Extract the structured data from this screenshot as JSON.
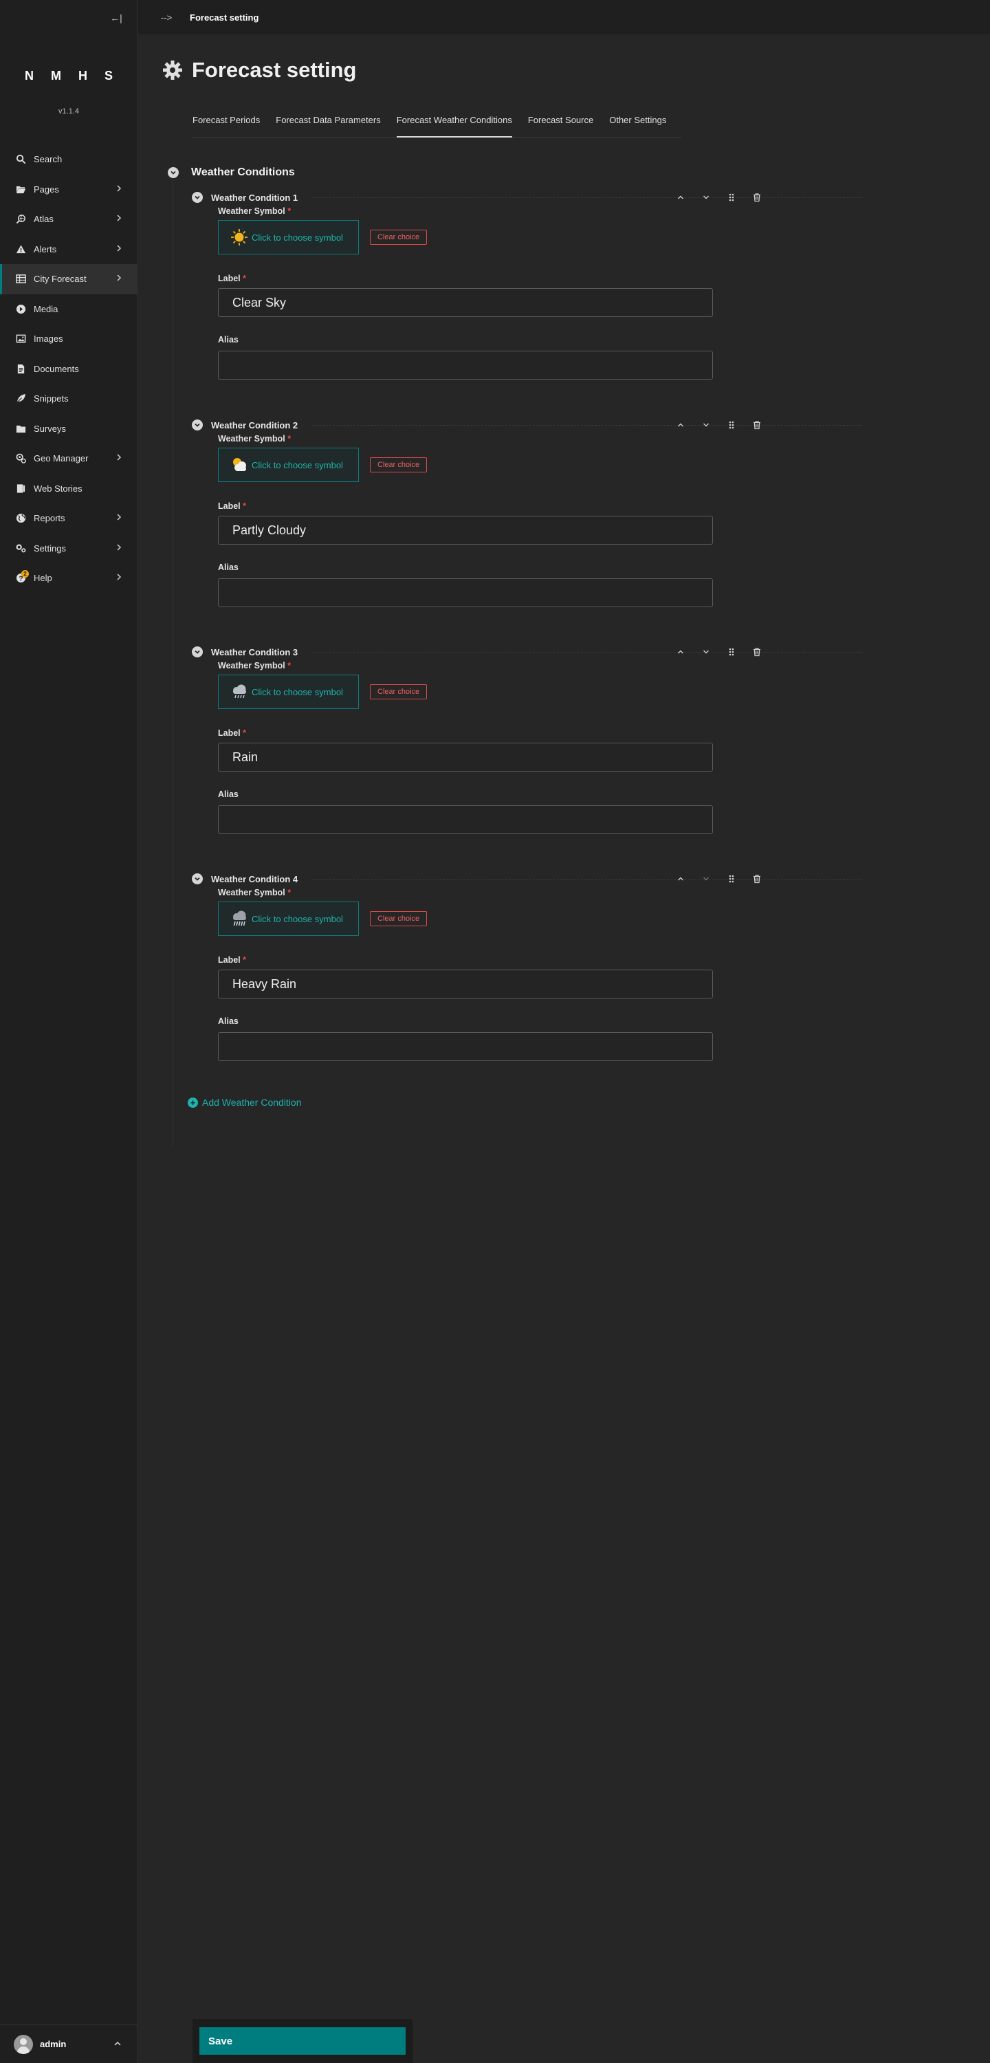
{
  "sidebar": {
    "collapse_label": "←|",
    "logo": "N M H S",
    "version": "v1.1.4",
    "items": [
      {
        "label": "Search",
        "icon": "search-icon",
        "chevron": false
      },
      {
        "label": "Pages",
        "icon": "folder-open-icon",
        "chevron": true
      },
      {
        "label": "Atlas",
        "icon": "globe-search-icon",
        "chevron": true
      },
      {
        "label": "Alerts",
        "icon": "warning-icon",
        "chevron": true
      },
      {
        "label": "City Forecast",
        "icon": "table-icon",
        "chevron": true,
        "active": true
      },
      {
        "label": "Media",
        "icon": "play-icon",
        "chevron": false
      },
      {
        "label": "Images",
        "icon": "image-icon",
        "chevron": false
      },
      {
        "label": "Documents",
        "icon": "document-icon",
        "chevron": false
      },
      {
        "label": "Snippets",
        "icon": "leaf-icon",
        "chevron": false
      },
      {
        "label": "Surveys",
        "icon": "folder-icon",
        "chevron": false
      },
      {
        "label": "Geo Manager",
        "icon": "map-settings-icon",
        "chevron": true
      },
      {
        "label": "Web Stories",
        "icon": "book-icon",
        "chevron": false
      },
      {
        "label": "Reports",
        "icon": "globe-icon",
        "chevron": true
      },
      {
        "label": "Settings",
        "icon": "cogs-icon",
        "chevron": true
      },
      {
        "label": "Help",
        "icon": "help-icon",
        "chevron": true,
        "badge": "2"
      }
    ],
    "account": {
      "name": "admin"
    }
  },
  "topbar": {
    "arrow": "-->",
    "breadcrumb": "Forecast setting"
  },
  "header": {
    "title": "Forecast setting",
    "icon": "gear-icon"
  },
  "tabs": [
    {
      "label": "Forecast Periods"
    },
    {
      "label": "Forecast Data Parameters"
    },
    {
      "label": "Forecast Weather Conditions",
      "active": true
    },
    {
      "label": "Forecast Source"
    },
    {
      "label": "Other Settings"
    }
  ],
  "section": {
    "title": "Weather Conditions"
  },
  "conditions": [
    {
      "title": "Weather Condition 1",
      "symbol_label": "Weather Symbol",
      "choose": "Click to choose symbol",
      "clear": "Clear choice",
      "label_caption": "Label",
      "label_value": "Clear Sky",
      "alias_caption": "Alias",
      "alias_value": "",
      "symbol_icon": "sun-icon"
    },
    {
      "title": "Weather Condition 2",
      "symbol_label": "Weather Symbol",
      "choose": "Click to choose symbol",
      "clear": "Clear choice",
      "label_caption": "Label",
      "label_value": "Partly Cloudy",
      "alias_caption": "Alias",
      "alias_value": "",
      "symbol_icon": "partly-cloudy-icon"
    },
    {
      "title": "Weather Condition 3",
      "symbol_label": "Weather Symbol",
      "choose": "Click to choose symbol",
      "clear": "Clear choice",
      "label_caption": "Label",
      "label_value": "Rain",
      "alias_caption": "Alias",
      "alias_value": "",
      "symbol_icon": "rain-cloud-icon"
    },
    {
      "title": "Weather Condition 4",
      "symbol_label": "Weather Symbol",
      "choose": "Click to choose symbol",
      "clear": "Clear choice",
      "label_caption": "Label",
      "label_value": "Heavy Rain",
      "alias_caption": "Alias",
      "alias_value": "",
      "symbol_icon": "heavy-rain-icon"
    }
  ],
  "add_condition": "Add Weather Condition",
  "footer": {
    "save": "Save"
  },
  "colors": {
    "accent": "#007d7e",
    "accent_text": "#1eb3ae",
    "danger": "#e5484d",
    "background": "#262626",
    "sidebar": "#1f1f1f"
  }
}
